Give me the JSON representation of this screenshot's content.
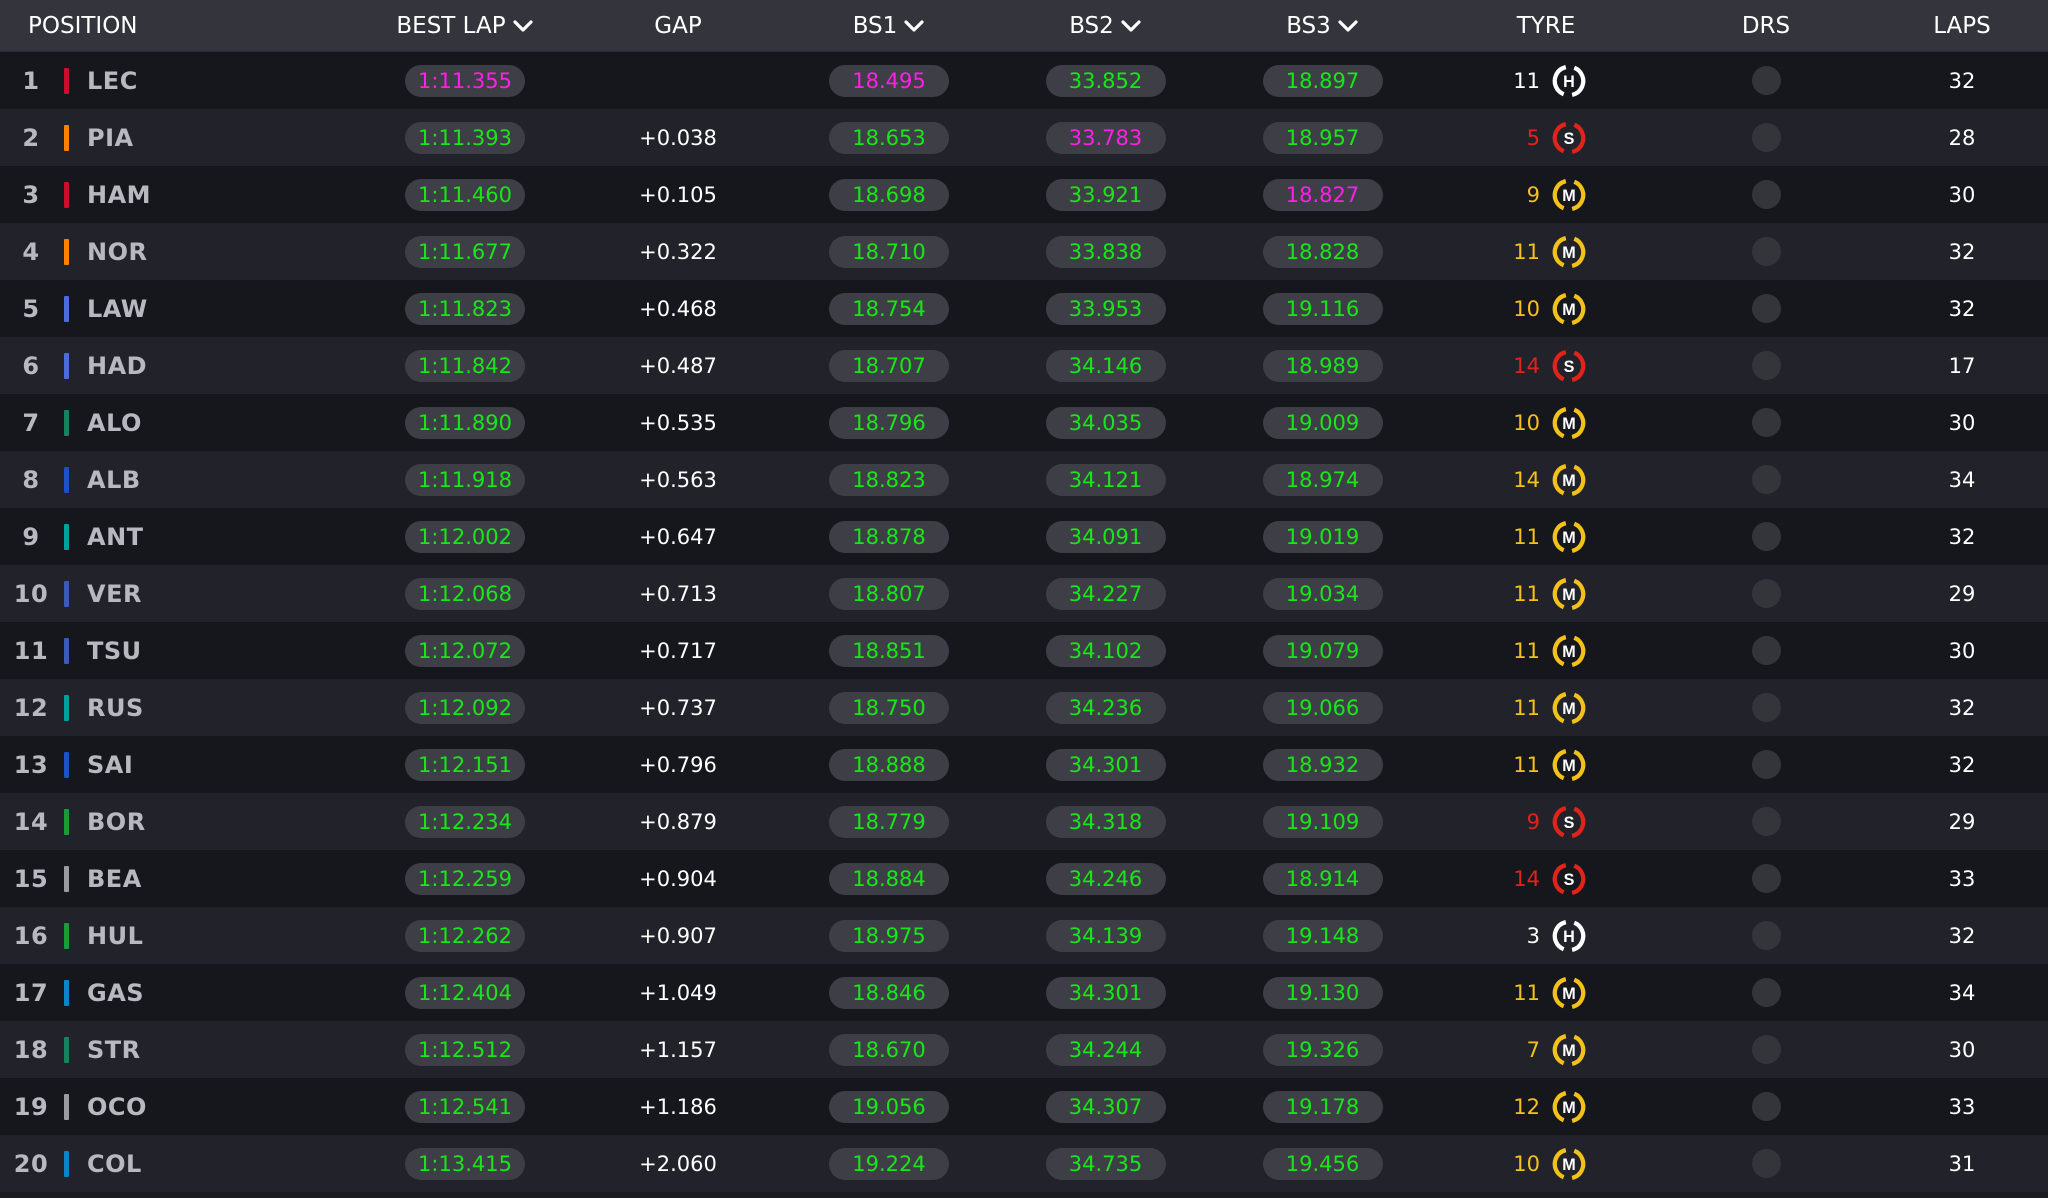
{
  "colors": {
    "personal_best": "#19e619",
    "overall_best": "#ff1fe8",
    "hard": "#ffffff",
    "soft": "#e2231a",
    "medium": "#f3c11a"
  },
  "header": {
    "position": "POSITION",
    "best_lap": "BEST LAP",
    "gap": "GAP",
    "bs1": "BS1",
    "bs2": "BS2",
    "bs3": "BS3",
    "tyre": "TYRE",
    "drs": "DRS",
    "laps": "LAPS"
  },
  "rows": [
    {
      "pos": "1",
      "driver": "LEC",
      "team_color": "#c8102e",
      "best_lap": "1:11.355",
      "best_lap_purple": true,
      "gap": "",
      "bs1": "18.495",
      "bs1_purple": true,
      "bs2": "33.852",
      "bs2_purple": false,
      "bs3": "18.897",
      "bs3_purple": false,
      "tyre_age": "11",
      "tyre": "H",
      "laps": "32"
    },
    {
      "pos": "2",
      "driver": "PIA",
      "team_color": "#ff8000",
      "best_lap": "1:11.393",
      "best_lap_purple": false,
      "gap": "+0.038",
      "bs1": "18.653",
      "bs1_purple": false,
      "bs2": "33.783",
      "bs2_purple": true,
      "bs3": "18.957",
      "bs3_purple": false,
      "tyre_age": "5",
      "tyre": "S",
      "laps": "28"
    },
    {
      "pos": "3",
      "driver": "HAM",
      "team_color": "#c8102e",
      "best_lap": "1:11.460",
      "best_lap_purple": false,
      "gap": "+0.105",
      "bs1": "18.698",
      "bs1_purple": false,
      "bs2": "33.921",
      "bs2_purple": false,
      "bs3": "18.827",
      "bs3_purple": true,
      "tyre_age": "9",
      "tyre": "M",
      "laps": "30"
    },
    {
      "pos": "4",
      "driver": "NOR",
      "team_color": "#ff8000",
      "best_lap": "1:11.677",
      "best_lap_purple": false,
      "gap": "+0.322",
      "bs1": "18.710",
      "bs1_purple": false,
      "bs2": "33.838",
      "bs2_purple": false,
      "bs3": "18.828",
      "bs3_purple": false,
      "tyre_age": "11",
      "tyre": "M",
      "laps": "32"
    },
    {
      "pos": "5",
      "driver": "LAW",
      "team_color": "#4b6cdd",
      "best_lap": "1:11.823",
      "best_lap_purple": false,
      "gap": "+0.468",
      "bs1": "18.754",
      "bs1_purple": false,
      "bs2": "33.953",
      "bs2_purple": false,
      "bs3": "19.116",
      "bs3_purple": false,
      "tyre_age": "10",
      "tyre": "M",
      "laps": "32"
    },
    {
      "pos": "6",
      "driver": "HAD",
      "team_color": "#4b6cdd",
      "best_lap": "1:11.842",
      "best_lap_purple": false,
      "gap": "+0.487",
      "bs1": "18.707",
      "bs1_purple": false,
      "bs2": "34.146",
      "bs2_purple": false,
      "bs3": "18.989",
      "bs3_purple": false,
      "tyre_age": "14",
      "tyre": "S",
      "laps": "17"
    },
    {
      "pos": "7",
      "driver": "ALO",
      "team_color": "#17825e",
      "best_lap": "1:11.890",
      "best_lap_purple": false,
      "gap": "+0.535",
      "bs1": "18.796",
      "bs1_purple": false,
      "bs2": "34.035",
      "bs2_purple": false,
      "bs3": "19.009",
      "bs3_purple": false,
      "tyre_age": "10",
      "tyre": "M",
      "laps": "30"
    },
    {
      "pos": "8",
      "driver": "ALB",
      "team_color": "#1e50c8",
      "best_lap": "1:11.918",
      "best_lap_purple": false,
      "gap": "+0.563",
      "bs1": "18.823",
      "bs1_purple": false,
      "bs2": "34.121",
      "bs2_purple": false,
      "bs3": "18.974",
      "bs3_purple": false,
      "tyre_age": "14",
      "tyre": "M",
      "laps": "34"
    },
    {
      "pos": "9",
      "driver": "ANT",
      "team_color": "#00a19c",
      "best_lap": "1:12.002",
      "best_lap_purple": false,
      "gap": "+0.647",
      "bs1": "18.878",
      "bs1_purple": false,
      "bs2": "34.091",
      "bs2_purple": false,
      "bs3": "19.019",
      "bs3_purple": false,
      "tyre_age": "11",
      "tyre": "M",
      "laps": "32"
    },
    {
      "pos": "10",
      "driver": "VER",
      "team_color": "#3a5bb8",
      "best_lap": "1:12.068",
      "best_lap_purple": false,
      "gap": "+0.713",
      "bs1": "18.807",
      "bs1_purple": false,
      "bs2": "34.227",
      "bs2_purple": false,
      "bs3": "19.034",
      "bs3_purple": false,
      "tyre_age": "11",
      "tyre": "M",
      "laps": "29"
    },
    {
      "pos": "11",
      "driver": "TSU",
      "team_color": "#3a5bb8",
      "best_lap": "1:12.072",
      "best_lap_purple": false,
      "gap": "+0.717",
      "bs1": "18.851",
      "bs1_purple": false,
      "bs2": "34.102",
      "bs2_purple": false,
      "bs3": "19.079",
      "bs3_purple": false,
      "tyre_age": "11",
      "tyre": "M",
      "laps": "30"
    },
    {
      "pos": "12",
      "driver": "RUS",
      "team_color": "#00a19c",
      "best_lap": "1:12.092",
      "best_lap_purple": false,
      "gap": "+0.737",
      "bs1": "18.750",
      "bs1_purple": false,
      "bs2": "34.236",
      "bs2_purple": false,
      "bs3": "19.066",
      "bs3_purple": false,
      "tyre_age": "11",
      "tyre": "M",
      "laps": "32"
    },
    {
      "pos": "13",
      "driver": "SAI",
      "team_color": "#1e50c8",
      "best_lap": "1:12.151",
      "best_lap_purple": false,
      "gap": "+0.796",
      "bs1": "18.888",
      "bs1_purple": false,
      "bs2": "34.301",
      "bs2_purple": false,
      "bs3": "18.932",
      "bs3_purple": false,
      "tyre_age": "11",
      "tyre": "M",
      "laps": "32"
    },
    {
      "pos": "14",
      "driver": "BOR",
      "team_color": "#1a9b3a",
      "best_lap": "1:12.234",
      "best_lap_purple": false,
      "gap": "+0.879",
      "bs1": "18.779",
      "bs1_purple": false,
      "bs2": "34.318",
      "bs2_purple": false,
      "bs3": "19.109",
      "bs3_purple": false,
      "tyre_age": "9",
      "tyre": "S",
      "laps": "29"
    },
    {
      "pos": "15",
      "driver": "BEA",
      "team_color": "#9a9ba0",
      "best_lap": "1:12.259",
      "best_lap_purple": false,
      "gap": "+0.904",
      "bs1": "18.884",
      "bs1_purple": false,
      "bs2": "34.246",
      "bs2_purple": false,
      "bs3": "18.914",
      "bs3_purple": false,
      "tyre_age": "14",
      "tyre": "S",
      "laps": "33"
    },
    {
      "pos": "16",
      "driver": "HUL",
      "team_color": "#1a9b3a",
      "best_lap": "1:12.262",
      "best_lap_purple": false,
      "gap": "+0.907",
      "bs1": "18.975",
      "bs1_purple": false,
      "bs2": "34.139",
      "bs2_purple": false,
      "bs3": "19.148",
      "bs3_purple": false,
      "tyre_age": "3",
      "tyre": "H",
      "laps": "32"
    },
    {
      "pos": "17",
      "driver": "GAS",
      "team_color": "#0a86c8",
      "best_lap": "1:12.404",
      "best_lap_purple": false,
      "gap": "+1.049",
      "bs1": "18.846",
      "bs1_purple": false,
      "bs2": "34.301",
      "bs2_purple": false,
      "bs3": "19.130",
      "bs3_purple": false,
      "tyre_age": "11",
      "tyre": "M",
      "laps": "34"
    },
    {
      "pos": "18",
      "driver": "STR",
      "team_color": "#17825e",
      "best_lap": "1:12.512",
      "best_lap_purple": false,
      "gap": "+1.157",
      "bs1": "18.670",
      "bs1_purple": false,
      "bs2": "34.244",
      "bs2_purple": false,
      "bs3": "19.326",
      "bs3_purple": false,
      "tyre_age": "7",
      "tyre": "M",
      "laps": "30"
    },
    {
      "pos": "19",
      "driver": "OCO",
      "team_color": "#9a9ba0",
      "best_lap": "1:12.541",
      "best_lap_purple": false,
      "gap": "+1.186",
      "bs1": "19.056",
      "bs1_purple": false,
      "bs2": "34.307",
      "bs2_purple": false,
      "bs3": "19.178",
      "bs3_purple": false,
      "tyre_age": "12",
      "tyre": "M",
      "laps": "33"
    },
    {
      "pos": "20",
      "driver": "COL",
      "team_color": "#0a86c8",
      "best_lap": "1:13.415",
      "best_lap_purple": false,
      "gap": "+2.060",
      "bs1": "19.224",
      "bs1_purple": false,
      "bs2": "34.735",
      "bs2_purple": false,
      "bs3": "19.456",
      "bs3_purple": false,
      "tyre_age": "10",
      "tyre": "M",
      "laps": "31"
    }
  ]
}
